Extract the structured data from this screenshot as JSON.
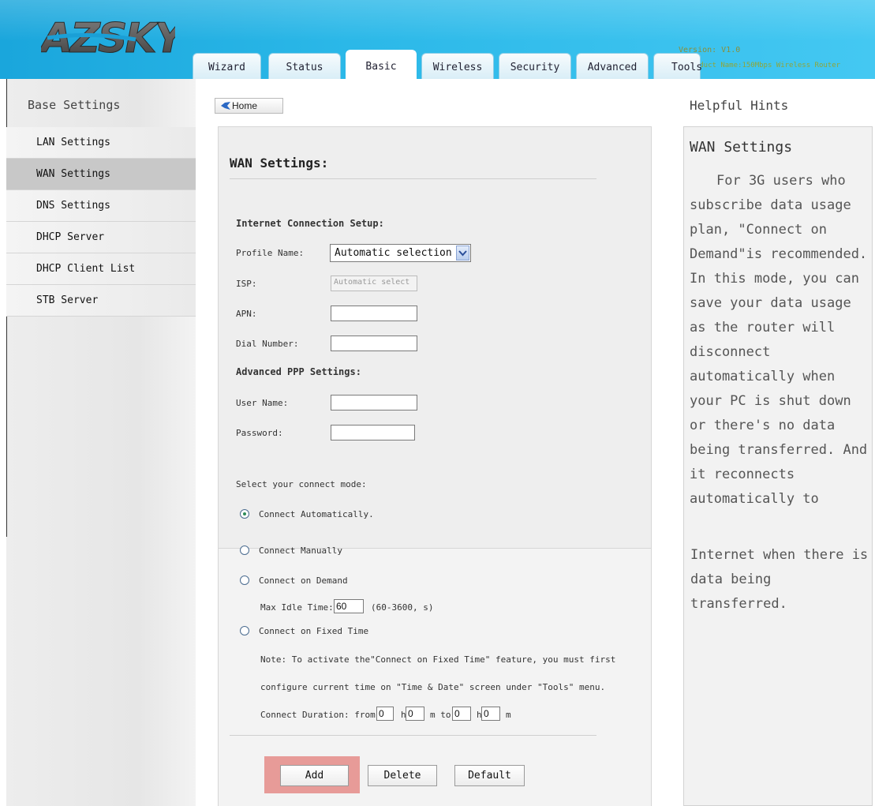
{
  "header": {
    "version": "Version: V1.0",
    "product_name": "Product Name:150Mbps Wireless Router",
    "logo_text": "AZSKY",
    "tabs": [
      {
        "label": "Wizard",
        "active": false
      },
      {
        "label": "Status",
        "active": false
      },
      {
        "label": "Basic",
        "active": true
      },
      {
        "label": "Wireless",
        "active": false
      },
      {
        "label": "Security",
        "active": false
      },
      {
        "label": "Advanced",
        "active": false
      },
      {
        "label": "Tools",
        "active": false
      }
    ]
  },
  "sidebar": {
    "title": "Base Settings",
    "items": [
      {
        "label": "LAN Settings",
        "active": false
      },
      {
        "label": "WAN Settings",
        "active": true
      },
      {
        "label": "DNS Settings",
        "active": false
      },
      {
        "label": "DHCP Server",
        "active": false
      },
      {
        "label": "DHCP Client List",
        "active": false
      },
      {
        "label": "STB Server",
        "active": false
      }
    ]
  },
  "home_button": {
    "label": "Home",
    "icon": "home-bird-icon"
  },
  "main": {
    "title": "WAN Settings:",
    "connection_setup_label": "Internet Connection Setup:",
    "profile_name_label": "Profile Name:",
    "profile_name_value": "Automatic selection",
    "isp_label": "ISP:",
    "isp_placeholder": "Automatic select",
    "apn_label": "APN:",
    "dial_number_label": "Dial Number:",
    "advanced_ppp_label": "Advanced PPP Settings:",
    "user_name_label": "User Name:",
    "password_label": "Password:",
    "connect_mode_label": "Select your connect mode:",
    "modes": [
      {
        "label": "Connect Automatically.",
        "checked": true
      },
      {
        "label": "Connect Manually",
        "checked": false
      },
      {
        "label": "Connect on Demand",
        "checked": false
      },
      {
        "label": "Connect on Fixed Time",
        "checked": false
      }
    ],
    "max_idle_label": "Max Idle Time:",
    "max_idle_value": "60",
    "max_idle_range": "(60-3600, s)",
    "note_line1": "Note: To activate the\"Connect on Fixed Time\" feature, you must first",
    "note_line2": "configure current time on \"Time & Date\" screen under \"Tools\" menu.",
    "duration": {
      "label": "Connect Duration: from",
      "from_h": "0",
      "h1": "h",
      "from_m": "0",
      "m1": "m to",
      "to_h": "0",
      "h2": "h",
      "to_m": "0",
      "m2": "m"
    },
    "buttons": {
      "add": "Add",
      "delete": "Delete",
      "default": "Default"
    }
  },
  "hints": {
    "title": "Helpful Hints",
    "heading": "WAN Settings",
    "body": "For 3G users who subscribe data usage plan, \"Connect on Demand\"is recommended. In this mode, you can save your data usage as the router will disconnect automatically when your PC is shut down or there's no data being transferred. And it reconnects automatically to",
    "body2": "Internet when there is data being transferred."
  },
  "colors": {
    "header_blue": "#2bb8e8",
    "add_highlight": "#e79b98",
    "sidebar_active": "#c8c8c8"
  }
}
